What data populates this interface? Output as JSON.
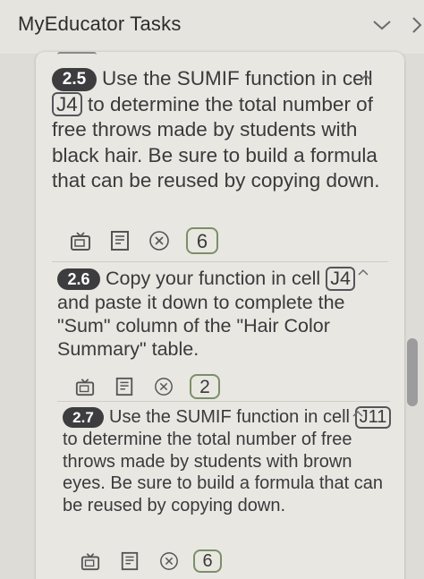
{
  "header": {
    "title": "MyEducator Tasks"
  },
  "tasks": [
    {
      "number": "2.5",
      "text_before_ref": "Use the SUMIF function in cell ",
      "cell_ref": "J4",
      "text_after_ref": " to determine the total number of free throws made by students with black hair. Be sure to build a formula that can be reused by copying down.",
      "score": "6"
    },
    {
      "number": "2.6",
      "text_before_ref": "Copy your function in cell ",
      "cell_ref": "J4",
      "text_after_ref": " and paste it down to complete the \"Sum\" column of the \"Hair Color Summary\" table.",
      "score": "2"
    },
    {
      "number": "2.7",
      "text_before_ref": "Use the SUMIF function in cell ",
      "cell_ref": "J11",
      "text_after_ref": " to determine the total number of free throws made by students with brown eyes. Be sure to build a formula that can be reused by copying down.",
      "score": "6"
    }
  ],
  "icons": {
    "header_toggle": "chevron-down-icon",
    "header_next": "chevron-right-icon",
    "task_collapse": "chevron-up-icon",
    "video": "video-icon",
    "reading": "book-icon",
    "status": "close-circle-icon"
  },
  "colors": {
    "badge": "#3d3d3f",
    "score_border": "#7b8f6a"
  }
}
